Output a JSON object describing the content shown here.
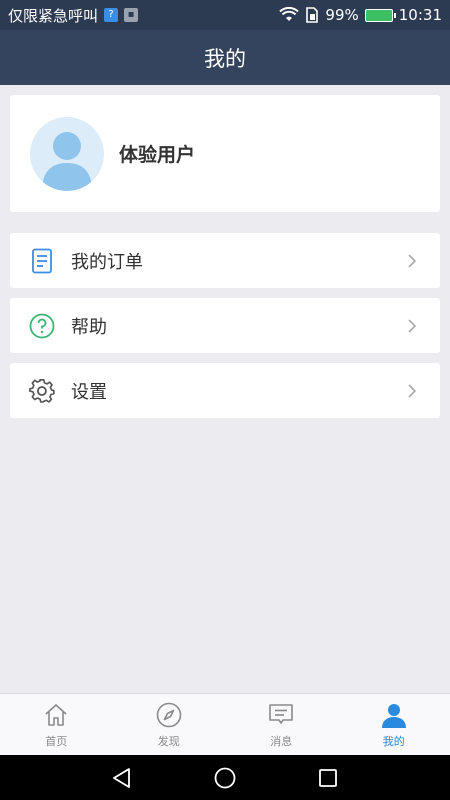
{
  "status_bar": {
    "carrier": "仅限紧急呼叫",
    "battery": "99%",
    "time": "10:31"
  },
  "header": {
    "title": "我的"
  },
  "profile": {
    "name": "体验用户"
  },
  "menu": [
    {
      "label": "我的订单",
      "icon": "order-document-icon"
    },
    {
      "label": "帮助",
      "icon": "help-question-icon"
    },
    {
      "label": "设置",
      "icon": "settings-gear-icon"
    }
  ],
  "tabs": [
    {
      "label": "首页",
      "icon": "home-icon",
      "active": false
    },
    {
      "label": "发现",
      "icon": "compass-icon",
      "active": false
    },
    {
      "label": "消息",
      "icon": "message-icon",
      "active": false
    },
    {
      "label": "我的",
      "icon": "user-icon",
      "active": true
    }
  ],
  "colors": {
    "header_bg": "#34435e",
    "active_tab": "#2a8ae0",
    "order_icon": "#3a8ee6",
    "help_icon": "#3cb371"
  }
}
